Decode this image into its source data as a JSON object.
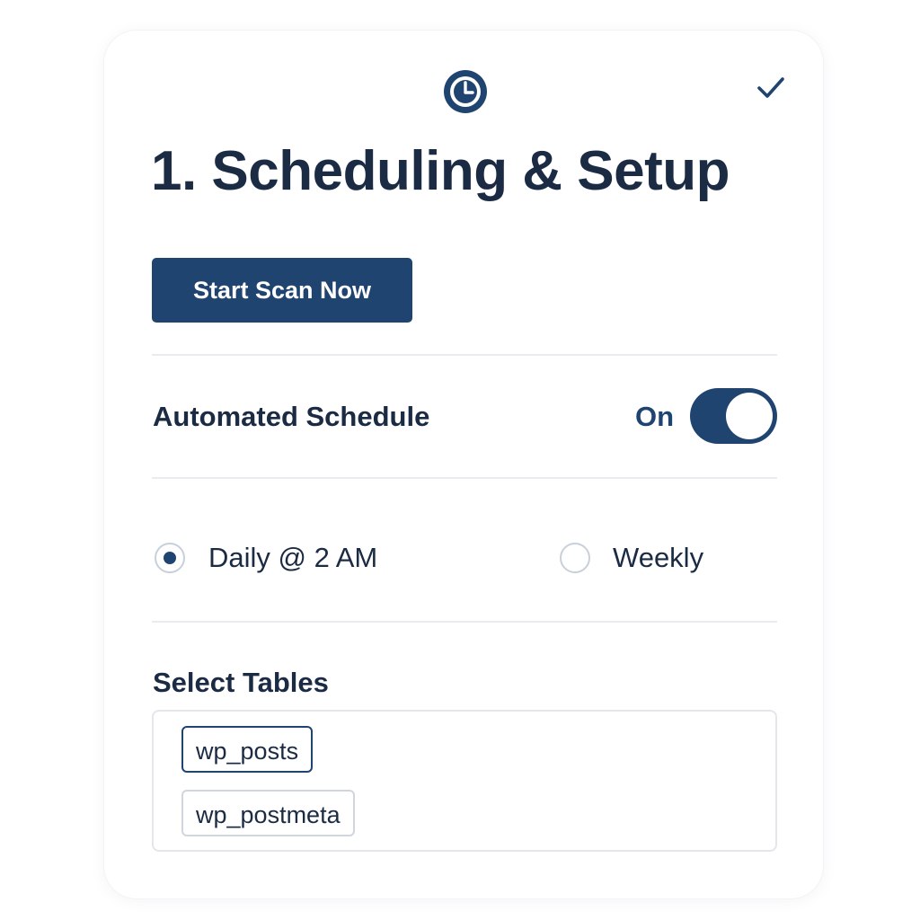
{
  "header": {
    "title": "1. Scheduling & Setup",
    "step_icon": "clock-icon",
    "status_icon": "check-icon"
  },
  "actions": {
    "scan_label": "Start Scan Now"
  },
  "schedule": {
    "label": "Automated Schedule",
    "toggle_state": "On",
    "enabled": true,
    "options": [
      {
        "label": "Daily @ 2 AM",
        "selected": true
      },
      {
        "label": "Weekly",
        "selected": false
      }
    ]
  },
  "tables": {
    "label": "Select Tables",
    "items": [
      {
        "label": "wp_posts",
        "selected": true
      },
      {
        "label": "wp_postmeta",
        "selected": false
      }
    ]
  },
  "colors": {
    "primary": "#1f4470",
    "text": "#1b2b44",
    "divider": "#e8ecf1"
  }
}
